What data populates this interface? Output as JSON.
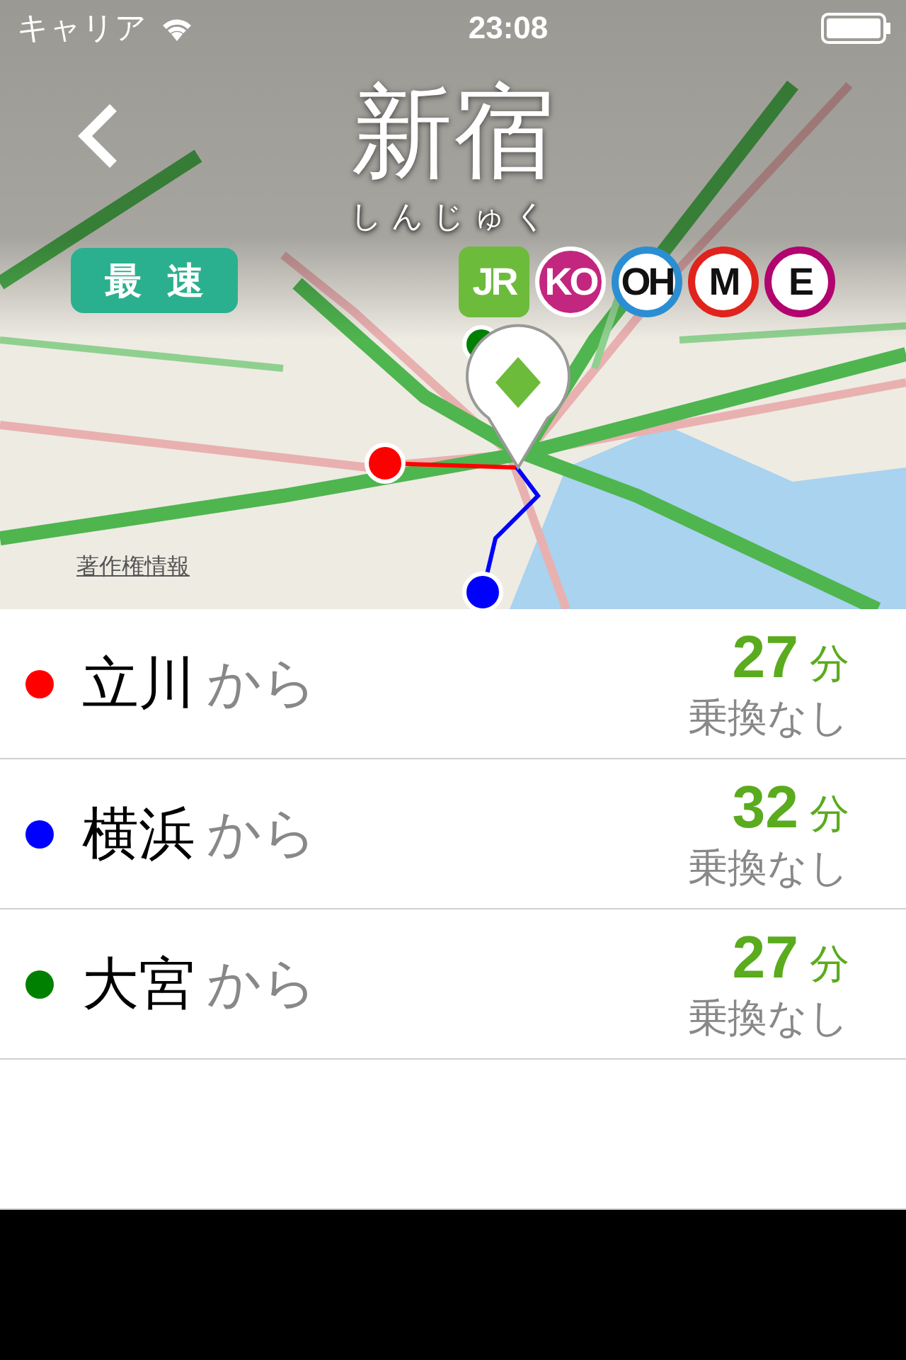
{
  "status_bar": {
    "carrier": "キャリア",
    "time": "23:08"
  },
  "header": {
    "title": "新宿",
    "reading": "しんじゅく",
    "mode_badge": "最速",
    "lines": [
      {
        "label": "JR",
        "kind": "square",
        "color": "#6dbb3b"
      },
      {
        "label": "KO",
        "kind": "disc",
        "color": "#c3267f"
      },
      {
        "label": "OH",
        "kind": "ring",
        "color": "#2b8ed3"
      },
      {
        "label": "M",
        "kind": "ring",
        "color": "#e0231c"
      },
      {
        "label": "E",
        "kind": "ring",
        "color": "#b1046f"
      }
    ]
  },
  "map": {
    "kind": "picture",
    "attribution": "著作権情報"
  },
  "routes": [
    {
      "station": "立川",
      "suffix": "から",
      "color": "#ff0000",
      "minutes": "27",
      "unit": "分",
      "transfers": "乗換なし"
    },
    {
      "station": "横浜",
      "suffix": "から",
      "color": "#0000ff",
      "minutes": "32",
      "unit": "分",
      "transfers": "乗換なし"
    },
    {
      "station": "大宮",
      "suffix": "から",
      "color": "#008000",
      "minutes": "27",
      "unit": "分",
      "transfers": "乗換なし"
    }
  ]
}
